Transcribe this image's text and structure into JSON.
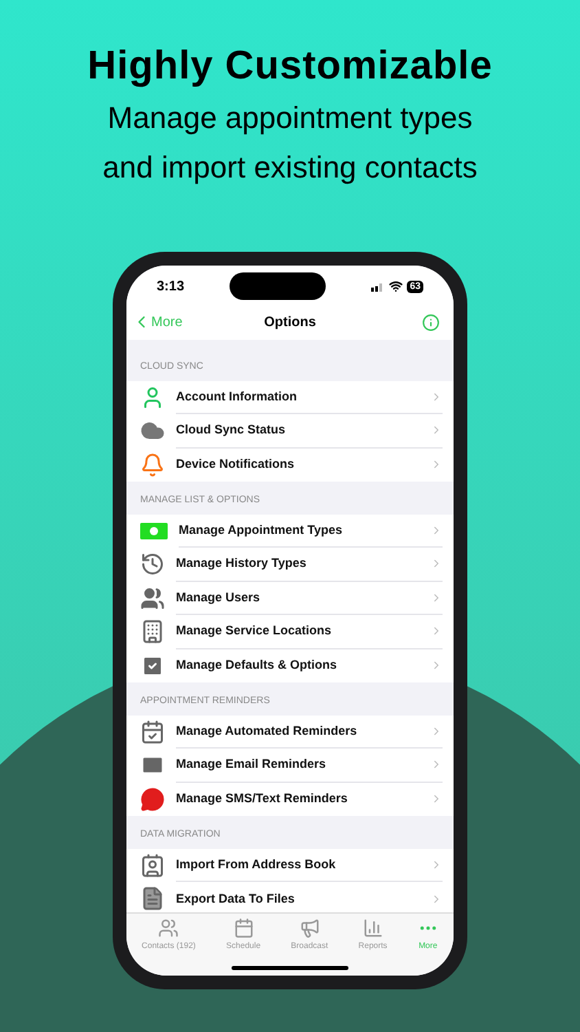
{
  "headline": {
    "title": "Highly Customizable",
    "subtitle": "Manage appointment types and import existing contacts"
  },
  "status_bar": {
    "time": "3:13",
    "battery": "63"
  },
  "nav": {
    "back": "More",
    "title": "Options"
  },
  "sections": [
    {
      "header": "CLOUD SYNC",
      "items": [
        "Account Information",
        "Cloud Sync Status",
        "Device Notifications"
      ]
    },
    {
      "header": "MANAGE LIST & OPTIONS",
      "items": [
        "Manage Appointment Types",
        "Manage History Types",
        "Manage Users",
        "Manage Service Locations",
        "Manage Defaults & Options"
      ]
    },
    {
      "header": "APPOINTMENT REMINDERS",
      "items": [
        "Manage Automated Reminders",
        "Manage Email Reminders",
        "Manage SMS/Text Reminders"
      ]
    },
    {
      "header": "DATA MIGRATION",
      "items": [
        "Import From Address Book",
        "Export Data To Files"
      ]
    }
  ],
  "tab_bar": [
    {
      "label": "Contacts (192)",
      "selected": false
    },
    {
      "label": "Schedule",
      "selected": false
    },
    {
      "label": "Broadcast",
      "selected": false
    },
    {
      "label": "Reports",
      "selected": false
    },
    {
      "label": "More",
      "selected": true
    }
  ]
}
